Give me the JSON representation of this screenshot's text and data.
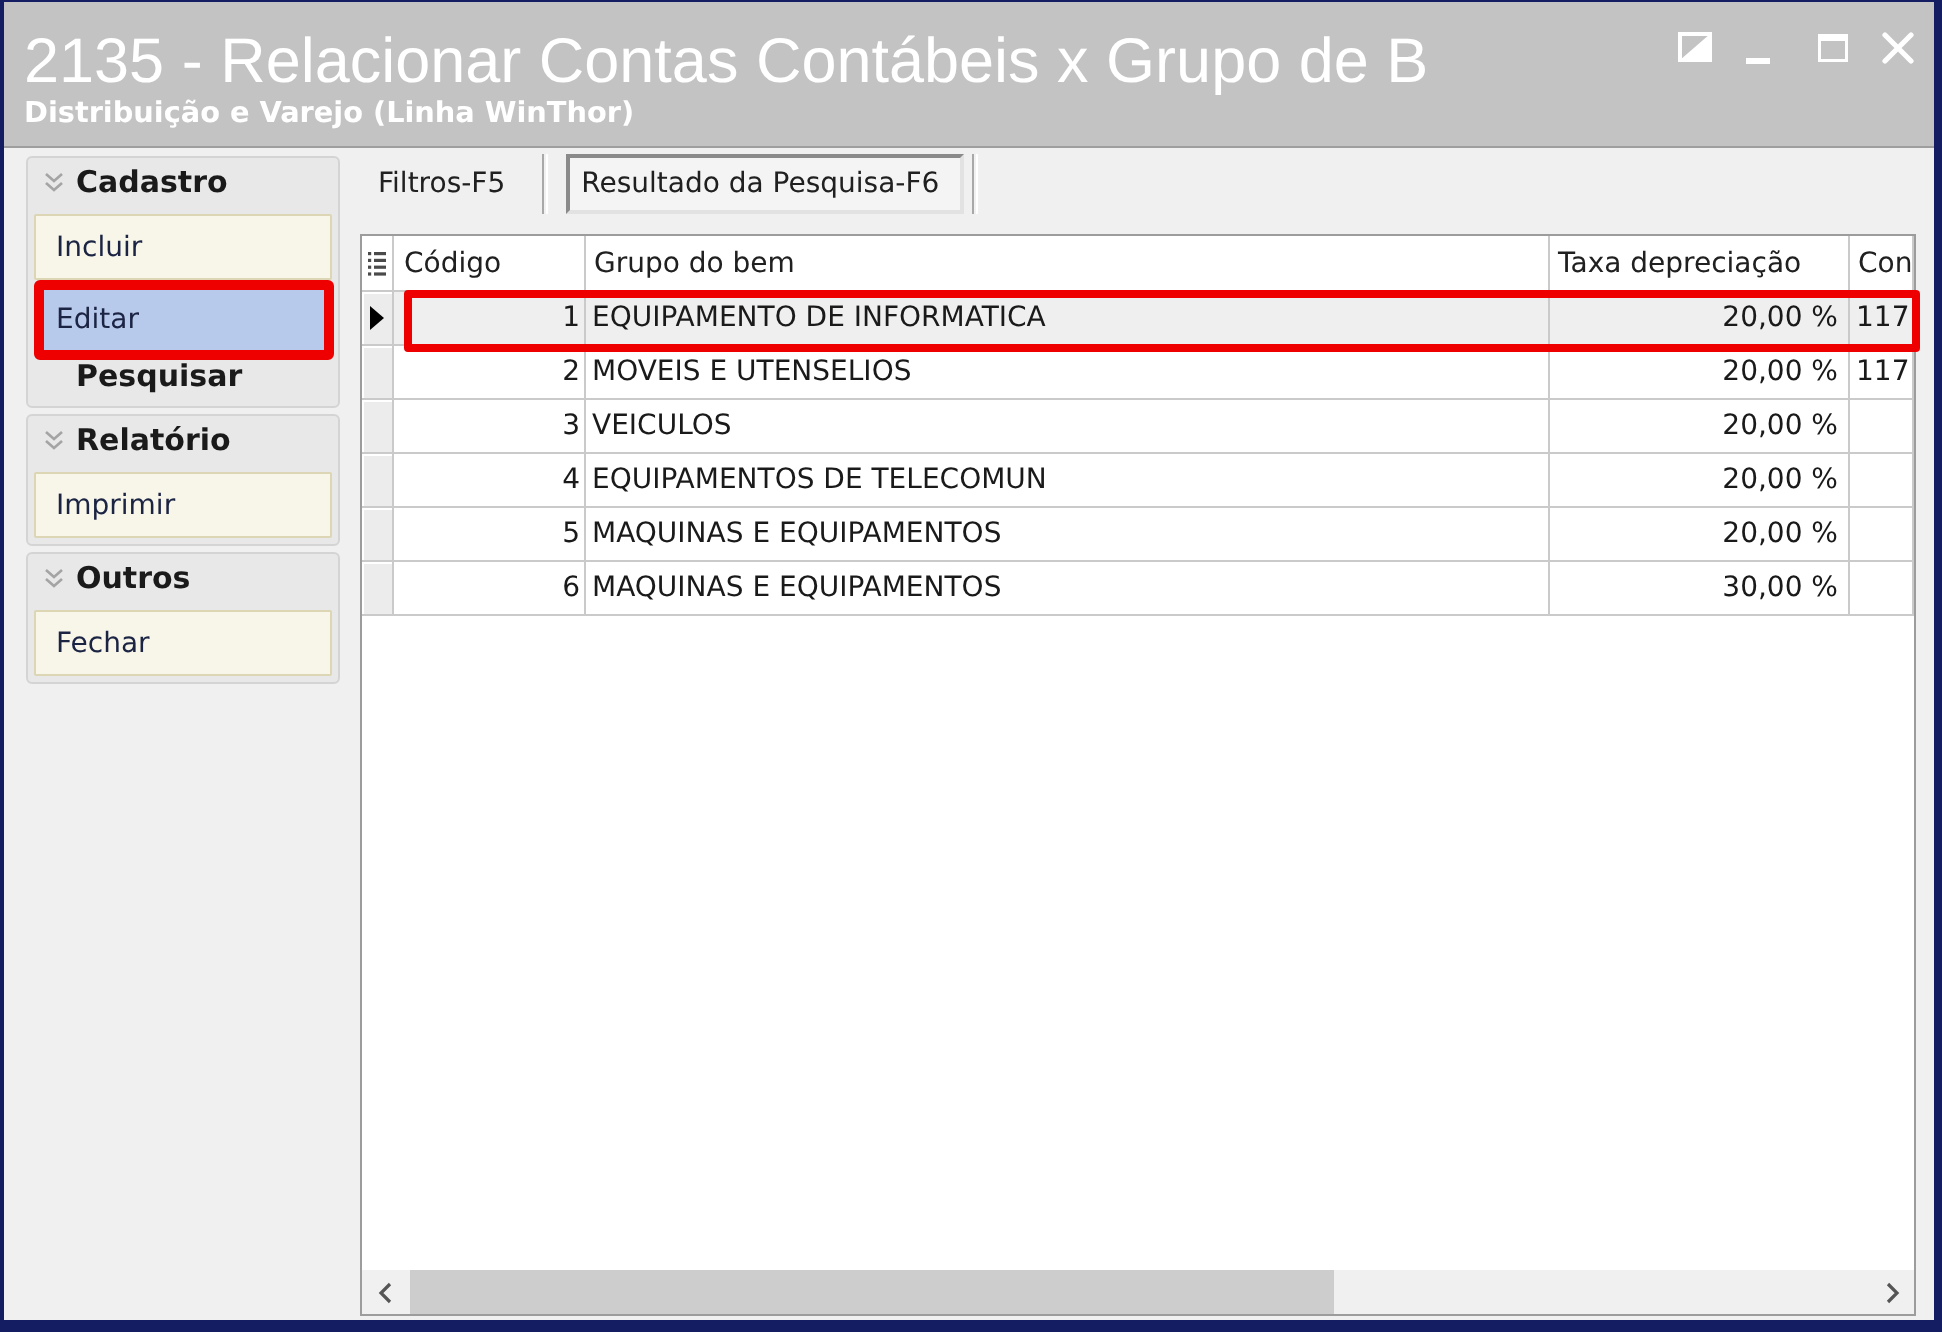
{
  "window": {
    "title": "2135 - Relacionar Contas Contábeis x Grupo de B",
    "subtitle": "Distribuição e Varejo (Linha WinThor)"
  },
  "sidebar": {
    "groups": [
      {
        "title": "Cadastro",
        "expanded": true,
        "items": [
          {
            "label": "Incluir",
            "selected": false,
            "highlighted": false
          },
          {
            "label": "Editar",
            "selected": true,
            "highlighted": true
          }
        ],
        "subheading": "Pesquisar"
      },
      {
        "title": "Relatório",
        "expanded": true,
        "items": [
          {
            "label": "Imprimir",
            "selected": false,
            "highlighted": false
          }
        ]
      },
      {
        "title": "Outros",
        "expanded": true,
        "items": [
          {
            "label": "Fechar",
            "selected": false,
            "highlighted": false
          }
        ]
      }
    ]
  },
  "tabs": [
    {
      "label": "Filtros-F5",
      "selected": false
    },
    {
      "label": "Resultado da Pesquisa-F6",
      "selected": true
    }
  ],
  "table": {
    "columns": [
      "Código",
      "Grupo do bem",
      "Taxa depreciação",
      "Con"
    ],
    "rows": [
      {
        "selected": true,
        "highlighted": true,
        "code": "1",
        "asset_group": "EQUIPAMENTO DE INFORMATICA",
        "depreciation_rate": "20,00 %",
        "column_4": "117"
      },
      {
        "selected": false,
        "highlighted": false,
        "code": "2",
        "asset_group": "MOVEIS E UTENSELIOS",
        "depreciation_rate": "20,00 %",
        "column_4": "117"
      },
      {
        "selected": false,
        "highlighted": false,
        "code": "3",
        "asset_group": "VEICULOS",
        "depreciation_rate": "20,00 %"
      },
      {
        "selected": false,
        "highlighted": false,
        "code": "4",
        "asset_group": "EQUIPAMENTOS DE TELECOMUN",
        "depreciation_rate": "20,00 %"
      },
      {
        "selected": false,
        "highlighted": false,
        "code": "5",
        "asset_group": "MAQUINAS E EQUIPAMENTOS",
        "depreciation_rate": "20,00 %"
      },
      {
        "selected": false,
        "highlighted": false,
        "code": "6",
        "asset_group": "MAQUINAS E EQUIPAMENTOS",
        "depreciation_rate": "30,00 %"
      }
    ]
  }
}
